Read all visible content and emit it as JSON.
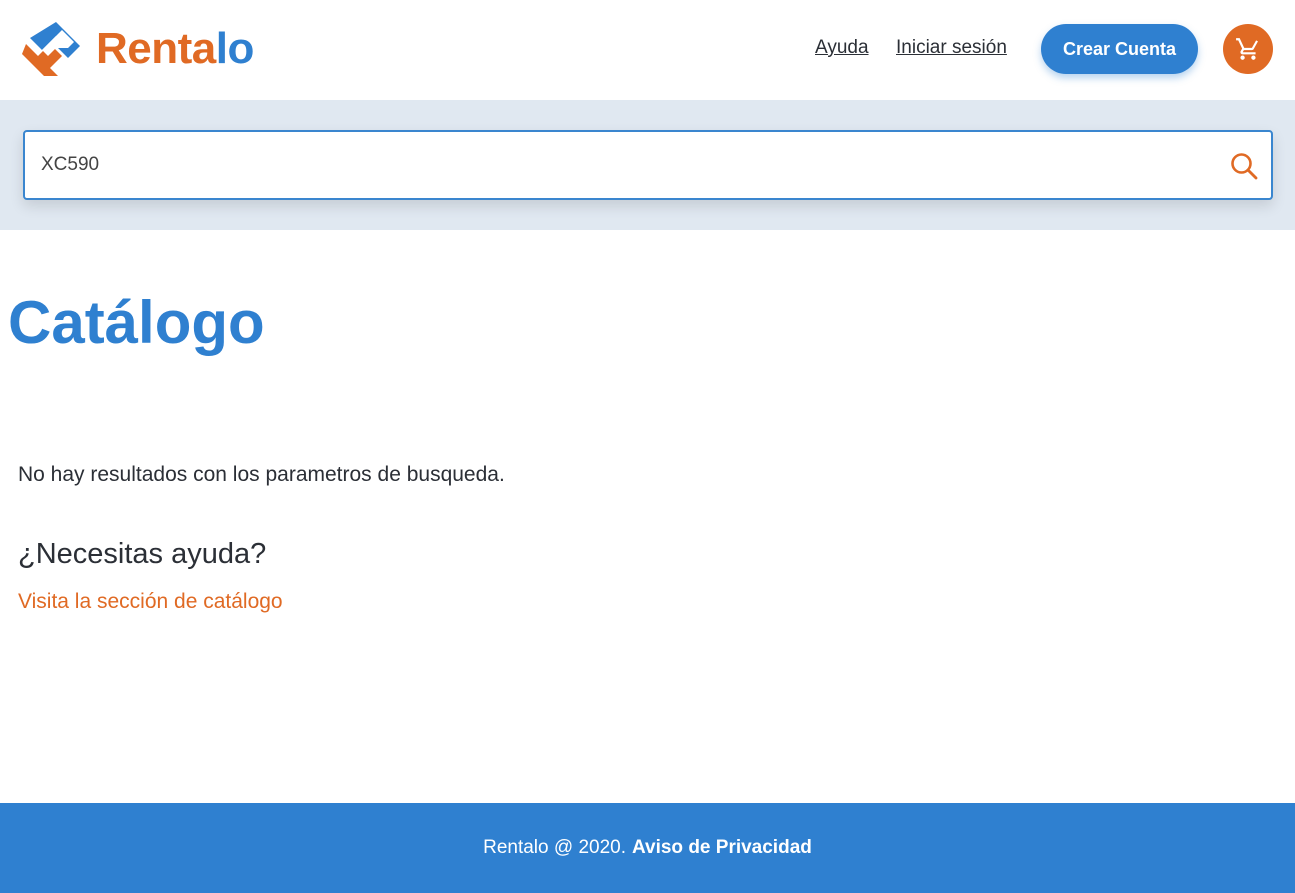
{
  "header": {
    "logo": {
      "text_a": "Renta",
      "text_b": "lo",
      "icon": "rentalo-logo-icon"
    },
    "nav": {
      "help_label": "Ayuda",
      "login_label": "Iniciar sesión",
      "create_account_label": "Crear Cuenta",
      "cart_icon": "cart-icon"
    }
  },
  "search": {
    "value": "XC590",
    "icon": "search-icon"
  },
  "main": {
    "title": "Catálogo",
    "no_results": "No hay resultados con los parametros de busqueda.",
    "help_heading": "¿Necesitas ayuda?",
    "help_link": "Visita la sección de catálogo"
  },
  "footer": {
    "copyright": "Rentalo @ 2020.",
    "privacy_label": "Aviso de Privacidad"
  },
  "colors": {
    "brand_blue": "#2f80d0",
    "brand_orange": "#e06a24",
    "search_band": "#e0e8f1"
  }
}
